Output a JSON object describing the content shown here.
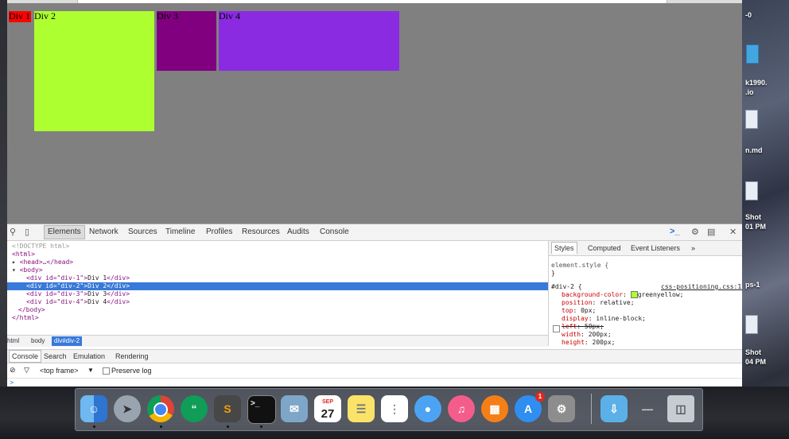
{
  "page": {
    "divs": [
      {
        "label": "Div 1",
        "color": "#ff0000"
      },
      {
        "label": "Div 2",
        "color": "#adff2f"
      },
      {
        "label": "Div 3",
        "color": "#800080"
      },
      {
        "label": "Div 4",
        "color": "#8a2be2"
      }
    ]
  },
  "devtools": {
    "tabs": [
      "Elements",
      "Network",
      "Sources",
      "Timeline",
      "Profiles",
      "Resources",
      "Audits",
      "Console"
    ],
    "active_tab": "Elements",
    "dom": {
      "doctype": "<!DOCTYPE html>",
      "html_open": "<html>",
      "head": "<head>…</head>",
      "body_open": "<body>",
      "div1_open": "<div id=\"div-1\">",
      "div1_text": "Div 1",
      "div2_open": "<div id=\"div-2\">",
      "div2_text": "Div 2",
      "div3_open": "<div id=\"div-3\">",
      "div3_text": "Div 3",
      "div4_open": "<div id=\"div-4\">",
      "div4_text": "Div 4",
      "div_close": "</div>",
      "body_close": "</body>",
      "html_close": "</html>"
    },
    "breadcrumbs": [
      "html",
      "body",
      "div#div-2"
    ],
    "styles_tabs": [
      "Styles",
      "Computed",
      "Event Listeners"
    ],
    "styles_more": "»",
    "element_style_selector": "element.style {",
    "element_style_close": "}",
    "rule_selector": "#div-2 {",
    "rule_source": "css-positioning.css:17",
    "rule_props": [
      {
        "name": "background-color",
        "value": "greenyellow;"
      },
      {
        "name": "position",
        "value": "relative;"
      },
      {
        "name": "top",
        "value": "0px;"
      },
      {
        "name": "display",
        "value": "inline-block;"
      },
      {
        "name": "left",
        "value": "50px;"
      },
      {
        "name": "width",
        "value": "200px;"
      },
      {
        "name": "height",
        "value": "200px;"
      }
    ],
    "drawer_tabs": [
      "Console",
      "Search",
      "Emulation",
      "Rendering"
    ],
    "frame_select": "<top frame>",
    "preserve_log": "Preserve log"
  },
  "desktop": {
    "labels": [
      "-0",
      "k1990.",
      ".io",
      "n.md",
      "Shot",
      "01 PM",
      "ps-1",
      "Shot",
      "04 PM"
    ]
  },
  "dock": {
    "calendar_month": "SEP",
    "calendar_day": "27",
    "app_store_badge": "1"
  }
}
